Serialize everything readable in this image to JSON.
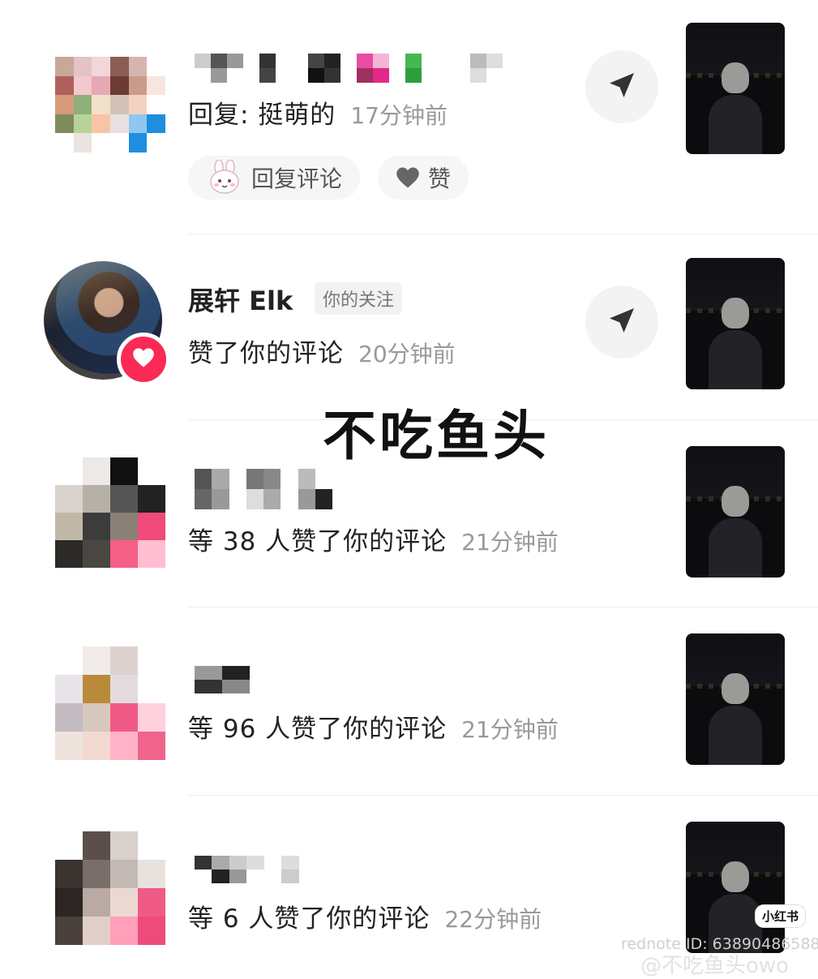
{
  "overlay_title": "不吃鱼头",
  "notifications": [
    {
      "text": "回复: 挺萌的",
      "time": "17分钟前",
      "actions": {
        "reply_label": "回复评论",
        "like_label": "赞"
      }
    },
    {
      "name": "展轩 Elk",
      "tag": "你的关注",
      "text": "赞了你的评论",
      "time": "20分钟前"
    },
    {
      "text": "等 38 人赞了你的评论",
      "time": "21分钟前"
    },
    {
      "text": "等 96 人赞了你的评论",
      "time": "21分钟前"
    },
    {
      "text": "等 6 人赞了你的评论",
      "time": "22分钟前"
    }
  ],
  "badge": "小红书",
  "watermark_id": "rednote ID: 63890486588",
  "watermark_weibo": "@不吃鱼头owo",
  "colors": {
    "accent": "#fa2a55",
    "muted": "#999999"
  },
  "icons": {
    "send": "paper-plane-icon",
    "heart": "heart-icon",
    "bunny": "bunny-sticker-icon"
  }
}
